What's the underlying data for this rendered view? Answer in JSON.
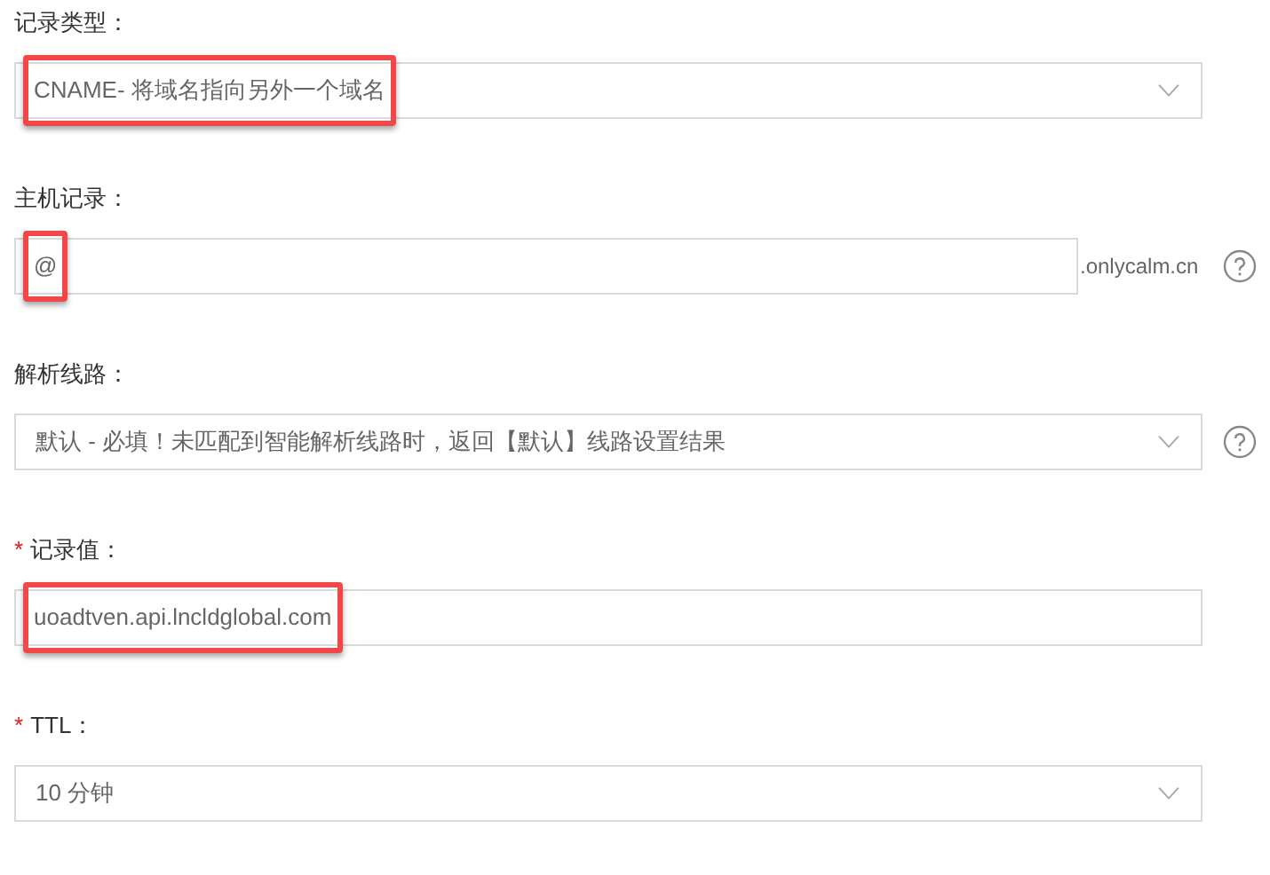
{
  "fields": [
    {
      "label": "记录类型：",
      "kind": "select",
      "value": "CNAME- 将域名指向另外一个域名",
      "highlighted": true,
      "help": false
    },
    {
      "label": "主机记录：",
      "kind": "input",
      "value": "@",
      "suffix": ".onlycalm.cn",
      "highlighted": true,
      "help": true
    },
    {
      "label": "解析线路：",
      "kind": "select",
      "value": "默认 - 必填！未匹配到智能解析线路时，返回【默认】线路设置结果",
      "highlighted": false,
      "help": true
    },
    {
      "required_mark": "*",
      "label": "记录值：",
      "kind": "input",
      "value": "uoadtven.api.lncldglobal.com",
      "highlighted": true,
      "help": false
    },
    {
      "required_mark": "*",
      "label": "TTL：",
      "kind": "select",
      "value": "10 分钟",
      "highlighted": false,
      "help": false
    }
  ]
}
